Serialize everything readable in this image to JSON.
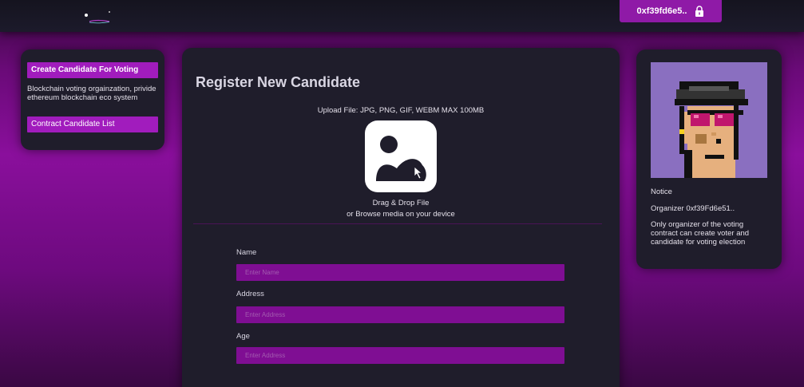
{
  "header": {
    "wallet_address": "0xf39fd6e5..",
    "lock_icon": "lock-icon",
    "logo_icon": "app-logo"
  },
  "sidebar": {
    "items": [
      {
        "label": "Create Candidate For Voting"
      },
      {
        "label": "Contract Candidate List"
      }
    ],
    "description": "Blockchain voting orgainzation, privide ethereum blockchain eco system"
  },
  "main": {
    "title": "Register New Candidate",
    "upload": {
      "hint": "Upload File: JPG, PNG, GIF, WEBM MAX 100MB",
      "icon": "image-icon",
      "drag_text": "Drag & Drop File",
      "browse_text": "or Browse media on your device"
    },
    "form": {
      "name": {
        "label": "Name",
        "placeholder": "Enter Name",
        "value": ""
      },
      "address": {
        "label": "Address",
        "placeholder": "Enter Address",
        "value": ""
      },
      "age": {
        "label": "Age",
        "placeholder": "Enter Address",
        "value": ""
      }
    }
  },
  "notice": {
    "title": "Notice",
    "organizer": "Organizer 0xf39Fd6e51..",
    "body": "Only organizer of the voting contract can create voter and candidate for voting election",
    "avatar_icon": "punk-avatar"
  },
  "colors": {
    "accent": "#a11cbd",
    "input_bg": "#7f0e93",
    "card_bg": "#1f1d2b",
    "topbar_bg": "#18172a"
  }
}
